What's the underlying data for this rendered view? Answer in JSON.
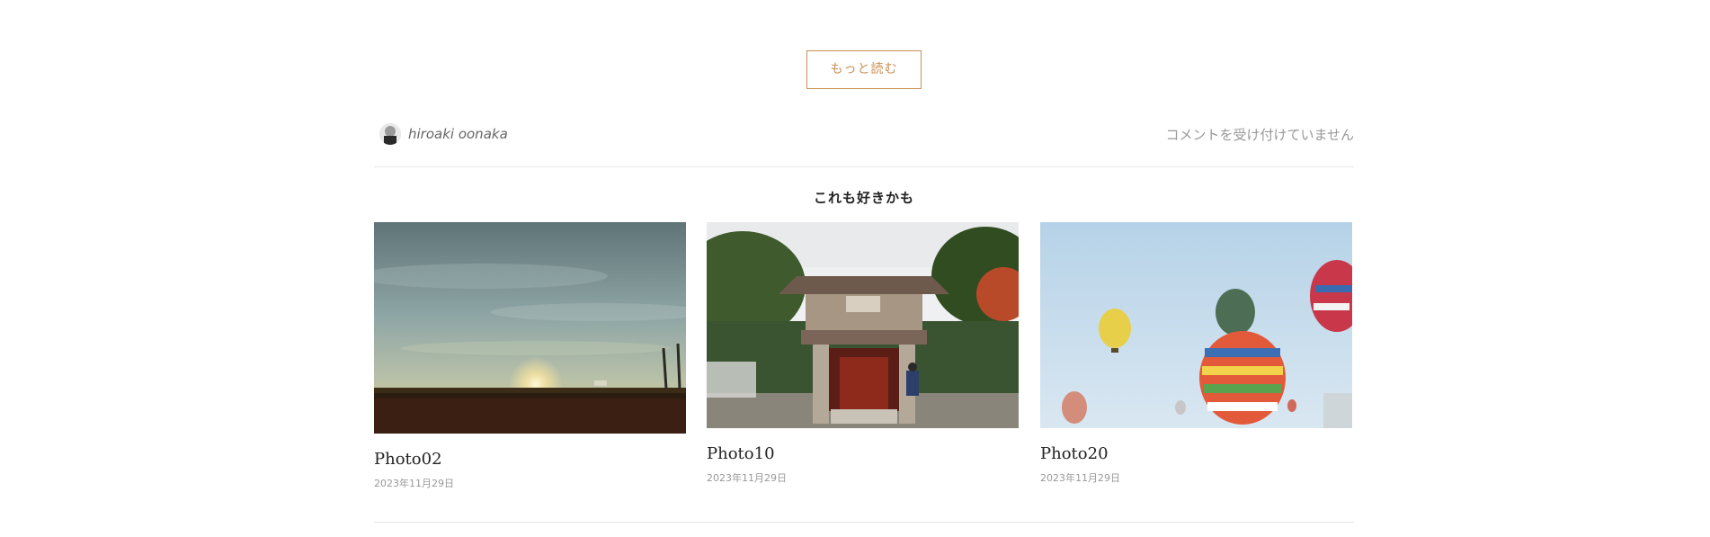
{
  "read_more": {
    "label": "もっと読む"
  },
  "author": {
    "name": "hiroaki oonaka"
  },
  "comments": {
    "status": "コメントを受け付けていません"
  },
  "related": {
    "heading": "これも好きかも",
    "posts": [
      {
        "title": "Photo02",
        "date": "2023年11月29日",
        "image_desc": "sunset"
      },
      {
        "title": "Photo10",
        "date": "2023年11月29日",
        "image_desc": "temple-gate"
      },
      {
        "title": "Photo20",
        "date": "2023年11月29日",
        "image_desc": "hot-air-balloons"
      }
    ]
  },
  "colors": {
    "accent": "#c98f55",
    "divider": "#e6e6e6",
    "muted_text": "#999999"
  }
}
